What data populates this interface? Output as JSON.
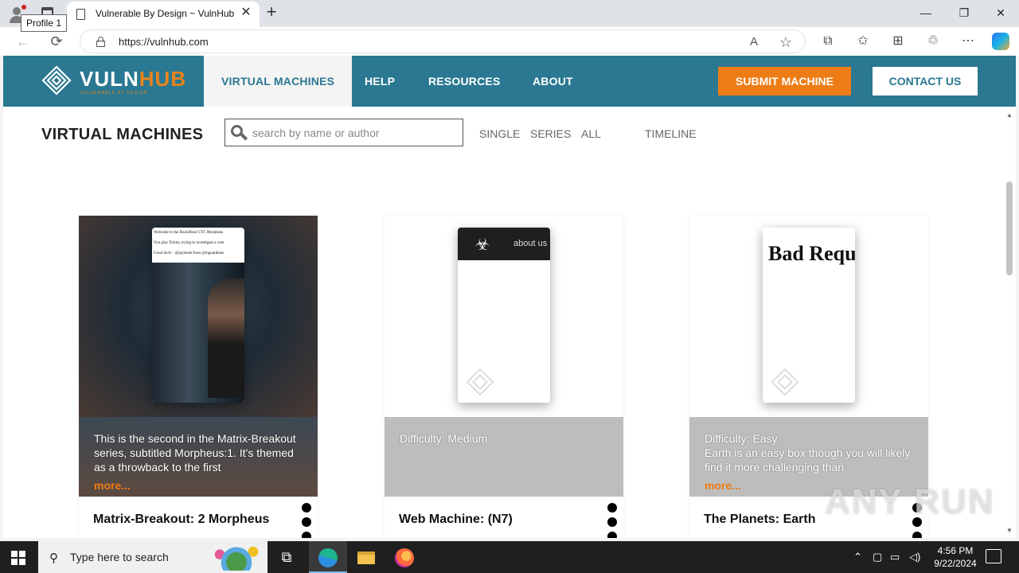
{
  "browser": {
    "tooltip": "Profile 1",
    "tab_title": "Vulnerable By Design ~ VulnHub",
    "tab_close": "✕",
    "new_tab": "+",
    "url": "https://vulnhub.com",
    "window": {
      "minimize": "—",
      "restore": "❐",
      "close": "✕"
    },
    "icons": {
      "back": "←",
      "refresh": "⟳",
      "read_aloud": "A",
      "favorite": "☆",
      "split": "⧉",
      "favorites": "✩",
      "collections": "⊞",
      "extensions": "♲",
      "more": "⋯"
    }
  },
  "site": {
    "logo_word_a": "VULN",
    "logo_word_b": "HUB",
    "logo_tagline": "VULNERABLE BY DESIGN",
    "nav": [
      "VIRTUAL MACHINES",
      "HELP",
      "RESOURCES",
      "ABOUT"
    ],
    "submit_label": "SUBMIT MACHINE",
    "contact_label": "CONTACT US",
    "accent": "#ee7c16",
    "brand": "#2a7891"
  },
  "toolbar": {
    "title": "VIRTUAL MACHINES",
    "search_placeholder": "search by name or author",
    "filters": [
      "SINGLE",
      "SERIES",
      "ALL",
      "TIMELINE"
    ]
  },
  "cards": [
    {
      "title": "Matrix-Breakout: 2 Morpheus",
      "difficulty": "",
      "description": "This is the second in the Matrix-Breakout series, subtitled Morpheus:1. It's themed as a throwback to the first",
      "more": "more...",
      "thumb_lines": [
        "Welcome to the Boot2Root CTF, Morpheus",
        "You play Trinity, trying to investigate a com",
        "Good luck! - @jaybeale from @inguardians"
      ]
    },
    {
      "title": "Web Machine: (N7)",
      "difficulty": "Difficulty: Medium",
      "description": "",
      "more": "",
      "thumb_nav": "about us"
    },
    {
      "title": "The Planets: Earth",
      "difficulty": "Difficulty: Easy",
      "description": "Earth is an easy box though you will likely find it more challenging than",
      "more": "more...",
      "thumb_heading": "Bad Requ"
    }
  ],
  "watermark": "ANY RUN",
  "taskbar": {
    "search_placeholder": "Type here to search",
    "time": "4:56 PM",
    "date": "9/22/2024"
  }
}
